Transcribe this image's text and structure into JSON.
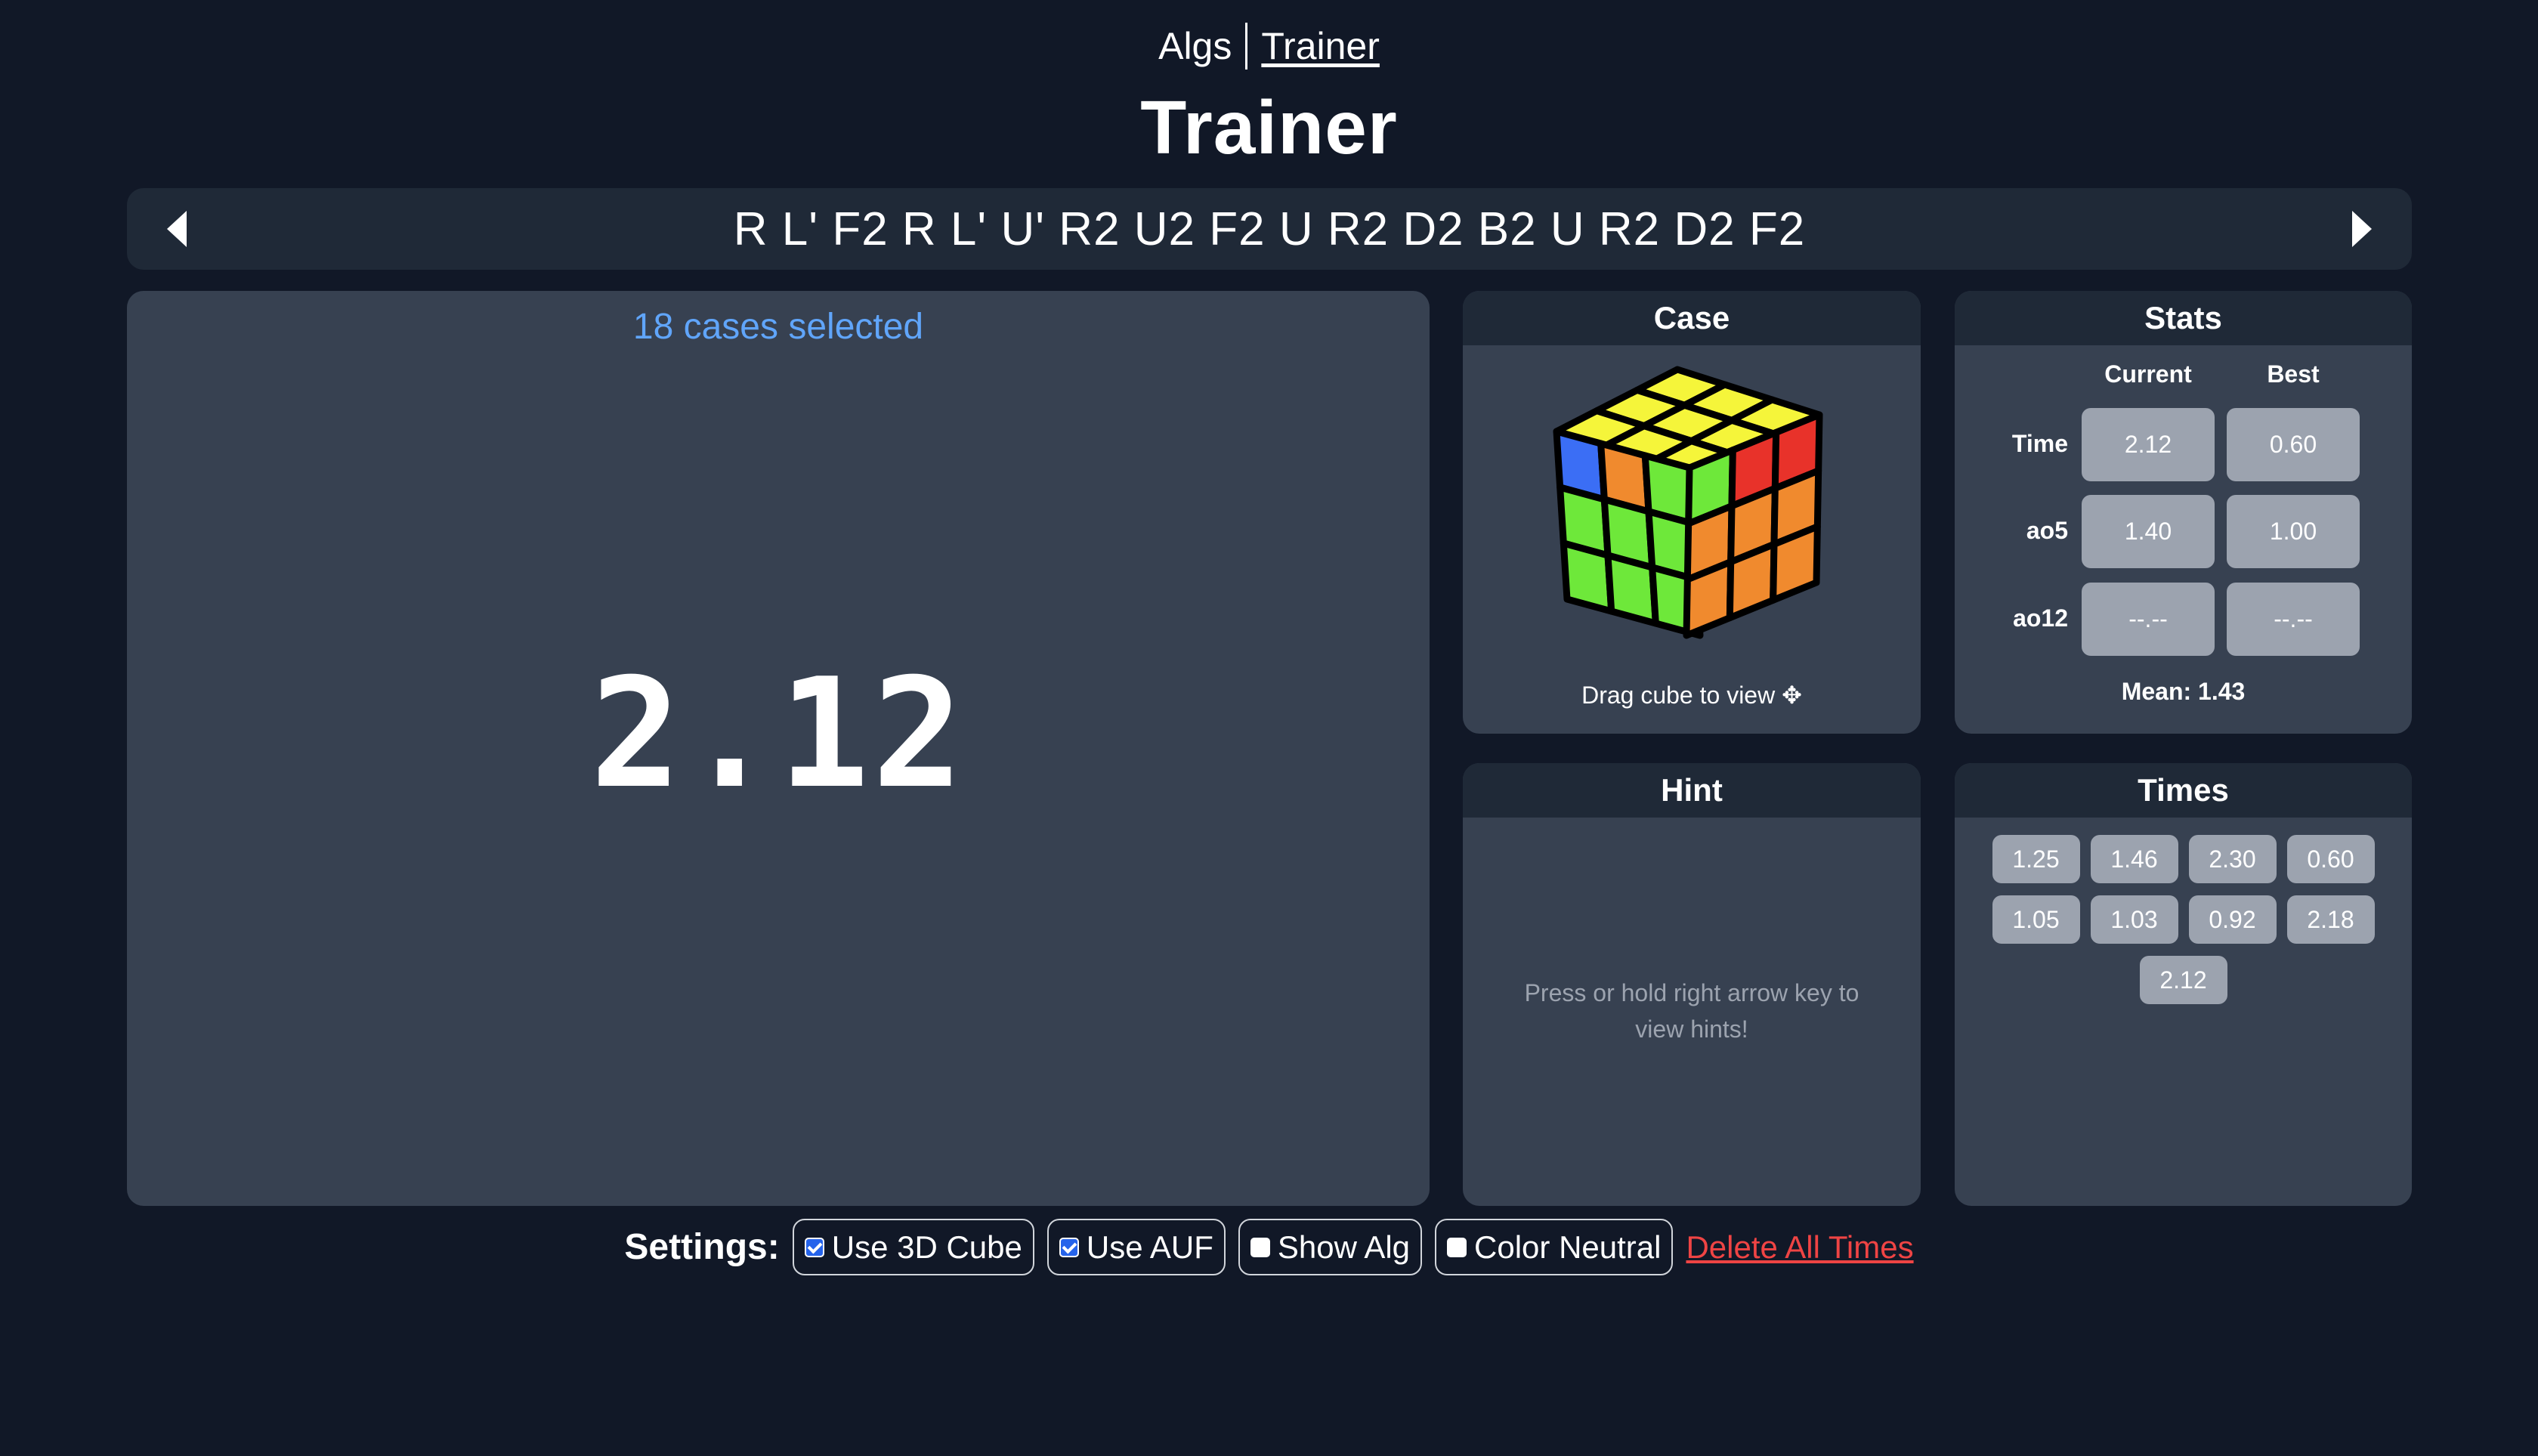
{
  "nav": {
    "algs_label": "Algs",
    "trainer_label": "Trainer"
  },
  "page_title": "Trainer",
  "scramble": {
    "text": "R L' F2 R L' U' R2 U2 F2 U R2 D2 B2 U R2 D2 F2",
    "prev_icon": "caret-left-icon",
    "next_icon": "caret-right-icon"
  },
  "timer": {
    "cases_selected": "18 cases selected",
    "display": "2.12"
  },
  "case_card": {
    "header": "Case",
    "drag_hint": "Drag cube to view ✥",
    "cube_colors": {
      "yellow": "#f5f53a",
      "blue": "#3b6ef5",
      "orange": "#f08a2e",
      "green": "#6ee83a",
      "red": "#e8322a"
    }
  },
  "stats_card": {
    "header": "Stats",
    "col_current": "Current",
    "col_best": "Best",
    "rows": [
      {
        "label": "Time",
        "current": "2.12",
        "best": "0.60"
      },
      {
        "label": "ao5",
        "current": "1.40",
        "best": "1.00"
      },
      {
        "label": "ao12",
        "current": "--.--",
        "best": "--.--"
      }
    ],
    "mean": "Mean: 1.43"
  },
  "hint_card": {
    "header": "Hint",
    "text": "Press or hold right arrow key to view hints!"
  },
  "times_card": {
    "header": "Times",
    "times": [
      "1.25",
      "1.46",
      "2.30",
      "0.60",
      "1.05",
      "1.03",
      "0.92",
      "2.18",
      "2.12"
    ]
  },
  "settings": {
    "label": "Settings:",
    "options": [
      {
        "label": "Use 3D Cube",
        "checked": true
      },
      {
        "label": "Use AUF",
        "checked": true
      },
      {
        "label": "Show Alg",
        "checked": false
      },
      {
        "label": "Color Neutral",
        "checked": false
      }
    ],
    "delete_label": "Delete All Times"
  }
}
